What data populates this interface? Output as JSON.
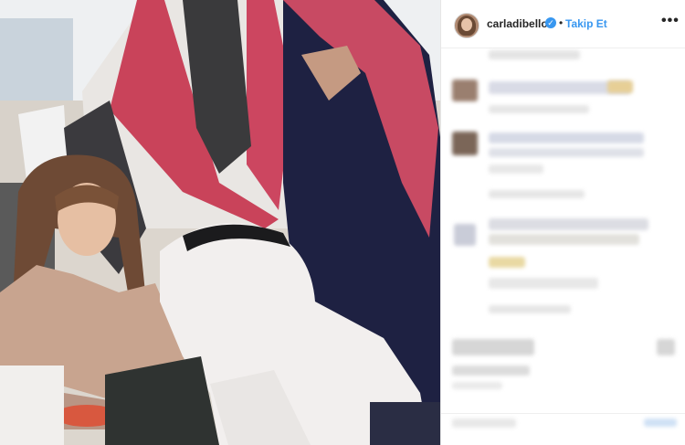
{
  "post": {
    "username": "carladibello",
    "follow_label": "Takip Et",
    "separator": "•",
    "verified_icon": "verified-badge-icon",
    "more_icon": "more-options-icon"
  },
  "colors": {
    "accent": "#3897f0",
    "text": "#262626",
    "border": "#efefef"
  }
}
